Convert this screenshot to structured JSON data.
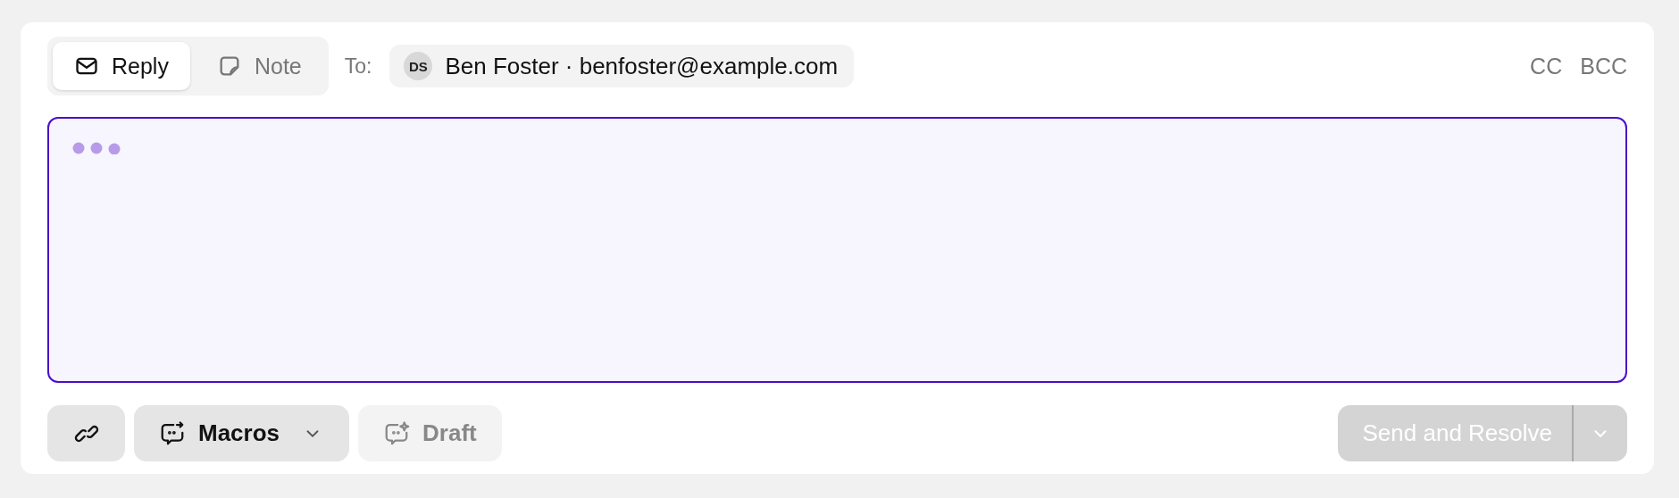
{
  "tabs": [
    {
      "label": "Reply",
      "selected": true
    },
    {
      "label": "Note",
      "selected": false
    }
  ],
  "to": {
    "label": "To:",
    "initials": "DS",
    "recipient": "Ben Foster · benfoster@example.com"
  },
  "copy_links": [
    "CC",
    "BCC"
  ],
  "editor": {
    "focused": true,
    "loading": true
  },
  "toolbar": [
    {
      "kind": "icon",
      "disabled": false
    },
    {
      "kind": "menu",
      "label": "Macros",
      "disabled": false
    },
    {
      "kind": "text",
      "label": "Draft",
      "disabled": true
    }
  ],
  "send": {
    "label": "Send and Resolve",
    "disabled": true
  }
}
